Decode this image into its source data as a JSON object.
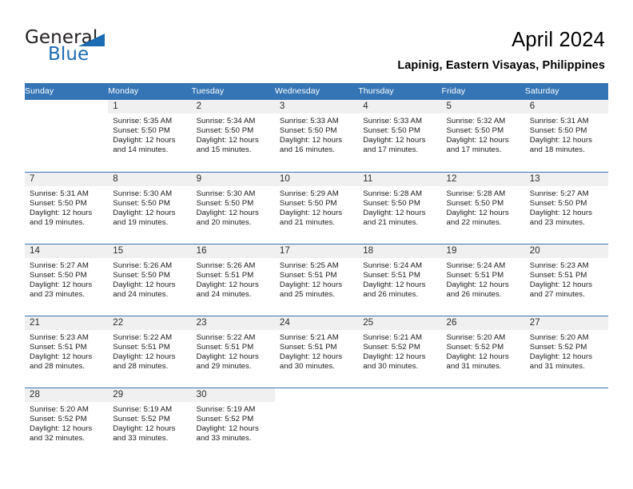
{
  "logo": {
    "word_one": "General",
    "word_two": "Blue",
    "triangle_color": "#1b6cb3"
  },
  "header": {
    "title": "April 2024",
    "subtitle": "Lapinig, Eastern Visayas, Philippines"
  },
  "theme": {
    "header_bg": "#3575b5",
    "daynum_bg": "#f0f0f0",
    "rule_color": "#3575b5",
    "text_color": "#1a1a1a"
  },
  "calendar": {
    "weekday_headers": [
      "Sunday",
      "Monday",
      "Tuesday",
      "Wednesday",
      "Thursday",
      "Friday",
      "Saturday"
    ],
    "weeks": [
      [
        {
          "day": "",
          "lines": []
        },
        {
          "day": "1",
          "lines": [
            "Sunrise: 5:35 AM",
            "Sunset: 5:50 PM",
            "Daylight: 12 hours",
            "and 14 minutes."
          ]
        },
        {
          "day": "2",
          "lines": [
            "Sunrise: 5:34 AM",
            "Sunset: 5:50 PM",
            "Daylight: 12 hours",
            "and 15 minutes."
          ]
        },
        {
          "day": "3",
          "lines": [
            "Sunrise: 5:33 AM",
            "Sunset: 5:50 PM",
            "Daylight: 12 hours",
            "and 16 minutes."
          ]
        },
        {
          "day": "4",
          "lines": [
            "Sunrise: 5:33 AM",
            "Sunset: 5:50 PM",
            "Daylight: 12 hours",
            "and 17 minutes."
          ]
        },
        {
          "day": "5",
          "lines": [
            "Sunrise: 5:32 AM",
            "Sunset: 5:50 PM",
            "Daylight: 12 hours",
            "and 17 minutes."
          ]
        },
        {
          "day": "6",
          "lines": [
            "Sunrise: 5:31 AM",
            "Sunset: 5:50 PM",
            "Daylight: 12 hours",
            "and 18 minutes."
          ]
        }
      ],
      [
        {
          "day": "7",
          "lines": [
            "Sunrise: 5:31 AM",
            "Sunset: 5:50 PM",
            "Daylight: 12 hours",
            "and 19 minutes."
          ]
        },
        {
          "day": "8",
          "lines": [
            "Sunrise: 5:30 AM",
            "Sunset: 5:50 PM",
            "Daylight: 12 hours",
            "and 19 minutes."
          ]
        },
        {
          "day": "9",
          "lines": [
            "Sunrise: 5:30 AM",
            "Sunset: 5:50 PM",
            "Daylight: 12 hours",
            "and 20 minutes."
          ]
        },
        {
          "day": "10",
          "lines": [
            "Sunrise: 5:29 AM",
            "Sunset: 5:50 PM",
            "Daylight: 12 hours",
            "and 21 minutes."
          ]
        },
        {
          "day": "11",
          "lines": [
            "Sunrise: 5:28 AM",
            "Sunset: 5:50 PM",
            "Daylight: 12 hours",
            "and 21 minutes."
          ]
        },
        {
          "day": "12",
          "lines": [
            "Sunrise: 5:28 AM",
            "Sunset: 5:50 PM",
            "Daylight: 12 hours",
            "and 22 minutes."
          ]
        },
        {
          "day": "13",
          "lines": [
            "Sunrise: 5:27 AM",
            "Sunset: 5:50 PM",
            "Daylight: 12 hours",
            "and 23 minutes."
          ]
        }
      ],
      [
        {
          "day": "14",
          "lines": [
            "Sunrise: 5:27 AM",
            "Sunset: 5:50 PM",
            "Daylight: 12 hours",
            "and 23 minutes."
          ]
        },
        {
          "day": "15",
          "lines": [
            "Sunrise: 5:26 AM",
            "Sunset: 5:50 PM",
            "Daylight: 12 hours",
            "and 24 minutes."
          ]
        },
        {
          "day": "16",
          "lines": [
            "Sunrise: 5:26 AM",
            "Sunset: 5:51 PM",
            "Daylight: 12 hours",
            "and 24 minutes."
          ]
        },
        {
          "day": "17",
          "lines": [
            "Sunrise: 5:25 AM",
            "Sunset: 5:51 PM",
            "Daylight: 12 hours",
            "and 25 minutes."
          ]
        },
        {
          "day": "18",
          "lines": [
            "Sunrise: 5:24 AM",
            "Sunset: 5:51 PM",
            "Daylight: 12 hours",
            "and 26 minutes."
          ]
        },
        {
          "day": "19",
          "lines": [
            "Sunrise: 5:24 AM",
            "Sunset: 5:51 PM",
            "Daylight: 12 hours",
            "and 26 minutes."
          ]
        },
        {
          "day": "20",
          "lines": [
            "Sunrise: 5:23 AM",
            "Sunset: 5:51 PM",
            "Daylight: 12 hours",
            "and 27 minutes."
          ]
        }
      ],
      [
        {
          "day": "21",
          "lines": [
            "Sunrise: 5:23 AM",
            "Sunset: 5:51 PM",
            "Daylight: 12 hours",
            "and 28 minutes."
          ]
        },
        {
          "day": "22",
          "lines": [
            "Sunrise: 5:22 AM",
            "Sunset: 5:51 PM",
            "Daylight: 12 hours",
            "and 28 minutes."
          ]
        },
        {
          "day": "23",
          "lines": [
            "Sunrise: 5:22 AM",
            "Sunset: 5:51 PM",
            "Daylight: 12 hours",
            "and 29 minutes."
          ]
        },
        {
          "day": "24",
          "lines": [
            "Sunrise: 5:21 AM",
            "Sunset: 5:51 PM",
            "Daylight: 12 hours",
            "and 30 minutes."
          ]
        },
        {
          "day": "25",
          "lines": [
            "Sunrise: 5:21 AM",
            "Sunset: 5:52 PM",
            "Daylight: 12 hours",
            "and 30 minutes."
          ]
        },
        {
          "day": "26",
          "lines": [
            "Sunrise: 5:20 AM",
            "Sunset: 5:52 PM",
            "Daylight: 12 hours",
            "and 31 minutes."
          ]
        },
        {
          "day": "27",
          "lines": [
            "Sunrise: 5:20 AM",
            "Sunset: 5:52 PM",
            "Daylight: 12 hours",
            "and 31 minutes."
          ]
        }
      ],
      [
        {
          "day": "28",
          "lines": [
            "Sunrise: 5:20 AM",
            "Sunset: 5:52 PM",
            "Daylight: 12 hours",
            "and 32 minutes."
          ]
        },
        {
          "day": "29",
          "lines": [
            "Sunrise: 5:19 AM",
            "Sunset: 5:52 PM",
            "Daylight: 12 hours",
            "and 33 minutes."
          ]
        },
        {
          "day": "30",
          "lines": [
            "Sunrise: 5:19 AM",
            "Sunset: 5:52 PM",
            "Daylight: 12 hours",
            "and 33 minutes."
          ]
        },
        {
          "day": "",
          "lines": []
        },
        {
          "day": "",
          "lines": []
        },
        {
          "day": "",
          "lines": []
        },
        {
          "day": "",
          "lines": []
        }
      ]
    ]
  }
}
